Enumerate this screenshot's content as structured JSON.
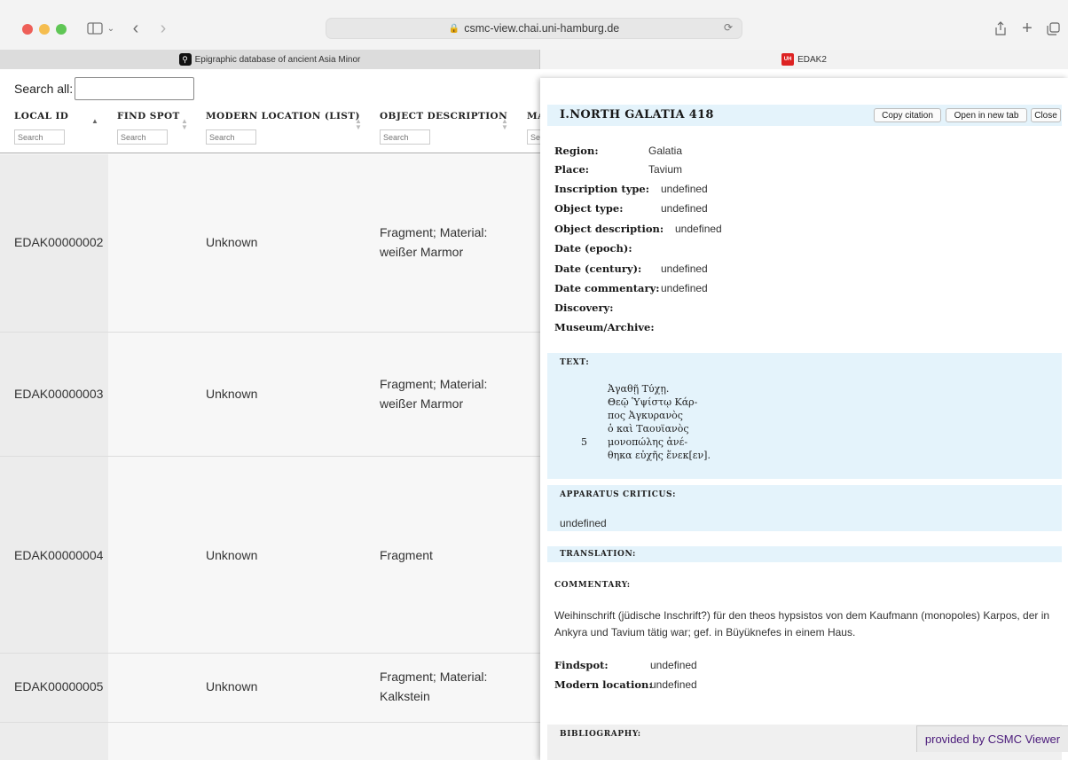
{
  "browser": {
    "url": "csmc-view.chai.uni-hamburg.de",
    "tabs": [
      {
        "label": "Epigraphic database of ancient Asia Minor"
      },
      {
        "label": "EDAK2"
      }
    ]
  },
  "table": {
    "search_all_label": "Search all:",
    "columns": [
      {
        "label": "LOCAL ID",
        "placeholder": "Search"
      },
      {
        "label": "FIND SPOT",
        "placeholder": "Search"
      },
      {
        "label": "MODERN LOCATION (LIST)",
        "placeholder": "Search"
      },
      {
        "label": "OBJECT DESCRIPTION",
        "placeholder": "Search"
      },
      {
        "label": "MA",
        "placeholder": "Se"
      }
    ],
    "rows": [
      {
        "id": "EDAK00000002",
        "modern": "Unknown",
        "desc1": "Fragment; Material:",
        "desc2": "weißer Marmor"
      },
      {
        "id": "EDAK00000003",
        "modern": "Unknown",
        "desc1": "Fragment; Material:",
        "desc2": "weißer Marmor"
      },
      {
        "id": "EDAK00000004",
        "modern": "Unknown",
        "desc1": "Fragment",
        "desc2": ""
      },
      {
        "id": "EDAK00000005",
        "modern": "Unknown",
        "desc1": "Fragment; Material:",
        "desc2": "Kalkstein"
      }
    ]
  },
  "panel": {
    "title": "I.NORTH GALATIA 418",
    "buttons": {
      "copy": "Copy citation",
      "open": "Open in new tab",
      "close": "Close"
    },
    "fields": [
      {
        "k": "Region:",
        "v": "Galatia"
      },
      {
        "k": "Place:",
        "v": "Tavium"
      },
      {
        "k": "Inscription type:",
        "v": "undefined"
      },
      {
        "k": "Object type:",
        "v": "undefined"
      },
      {
        "k": "Object description:",
        "v": "undefined"
      },
      {
        "k": "Date (epoch):",
        "v": ""
      },
      {
        "k": "Date (century):",
        "v": "undefined"
      },
      {
        "k": "Date commentary:",
        "v": "undefined"
      },
      {
        "k": "Discovery:",
        "v": ""
      },
      {
        "k": "Museum/Archive:",
        "v": ""
      }
    ],
    "text_header": "TEXT:",
    "text_lines": [
      "Ἀγαθῇ Τύχῃ.",
      "Θεῷ Ὑψίστῳ Κάρ-",
      "πος Ἀγκυρανὸς",
      "ὁ καὶ Ταουϊανὸς",
      "μονοπώλης ἀνέ-",
      "θηκα εὐχῆς ἕνεκ[εν]."
    ],
    "line_number": "5",
    "apparatus_header": "APPARATUS CRITICUS:",
    "apparatus_value": "undefined",
    "translation_header": "TRANSLATION:",
    "commentary_header": "COMMENTARY:",
    "commentary": "Weihinschrift (jüdische Inschrift?) für den theos hypsistos von dem Kaufmann (monopoles) Karpos, der in Ankyra und Tavium tätig war; gef. in Büyüknefes in einem Haus.",
    "findspot": {
      "k": "Findspot:",
      "v": "undefined"
    },
    "modern_location": {
      "k": "Modern location:",
      "v": "undefined"
    },
    "bibliography_header": "BIBLIOGRAPHY:"
  },
  "footer": {
    "provided_by": "provided by CSMC Viewer"
  }
}
